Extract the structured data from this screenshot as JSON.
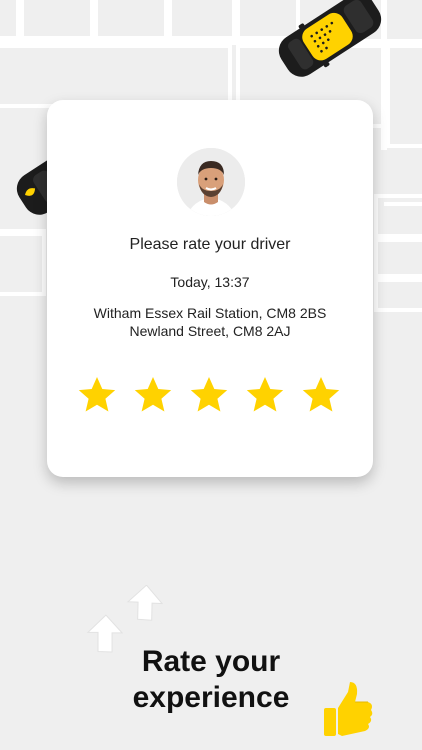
{
  "card": {
    "title": "Please rate your driver",
    "time": "Today, 13:37",
    "address_line_1": "Witham Essex Rail Station, CM8 2BS",
    "address_line_2": "Newland Street, CM8 2AJ"
  },
  "rating": {
    "stars_total": 5,
    "stars_filled": 5,
    "star_color": "#FFD200"
  },
  "headline": {
    "line1": "Rate your",
    "line2": "experience"
  },
  "colors": {
    "taxi_yellow": "#FFD200",
    "car_black": "#1c1c1c",
    "map_background": "#efefef",
    "map_road": "#ffffff"
  },
  "icons": [
    "driver-avatar",
    "star-icon",
    "taxi-car",
    "up-arrow-icon",
    "thumbs-up-icon"
  ]
}
